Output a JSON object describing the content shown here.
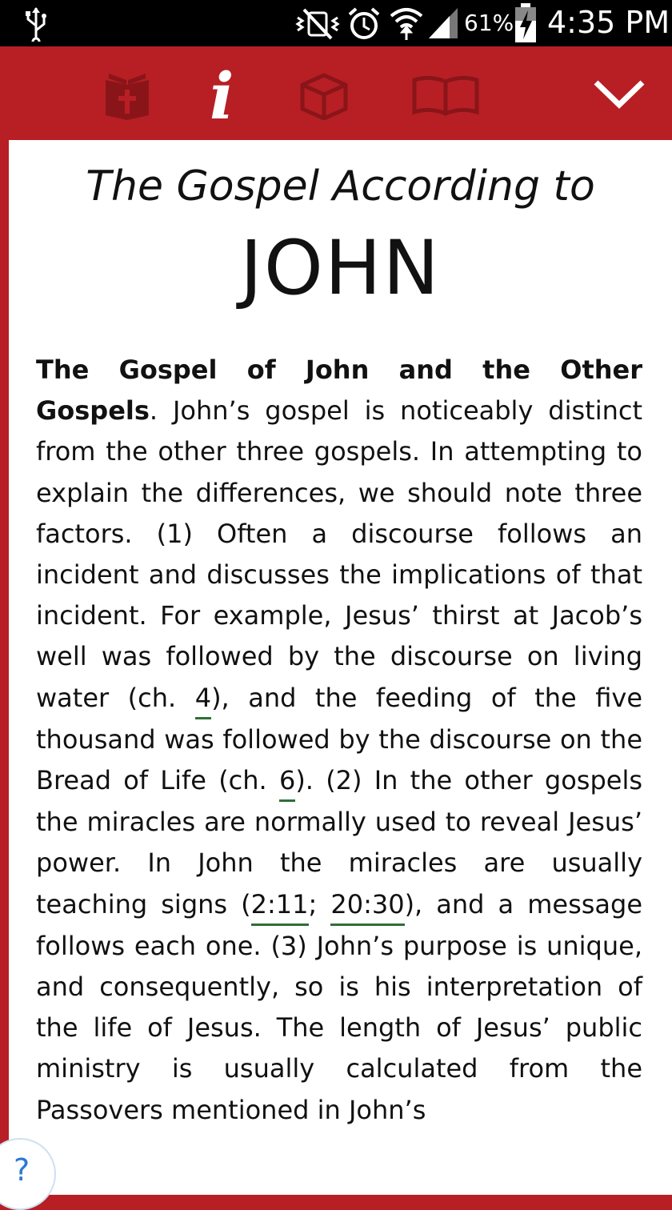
{
  "status_bar": {
    "battery_percent": "61%",
    "time": "4:35 PM",
    "icons": [
      "usb-icon",
      "vibrate-mute-icon",
      "alarm-icon",
      "wifi-icon",
      "signal-icon",
      "battery-charging-icon"
    ]
  },
  "toolbar": {
    "icons": [
      "bible-icon",
      "info-icon",
      "box-icon",
      "open-book-icon",
      "chevron-down-icon"
    ],
    "info_glyph": "i"
  },
  "content": {
    "subtitle": "The Gospel According to",
    "title": "JOHN",
    "paragraph": {
      "heading": "The Gospel of John and the Other Gospels",
      "p1": ". John’s gospel is noticeably distinct from the other three gospels. In attempting to explain the differences, we should note three factors. (1) Often a discourse follows an incident and discusses the implications of that incident. For example, Jesus’ thirst at Jacob’s well was followed by the discourse on living water (ch. ",
      "ref1": "4",
      "p2": "), and the feeding of the five thousand was followed by the discourse on the Bread of Life (ch. ",
      "ref2": "6",
      "p3": "). (2) In the other gospels the miracles are normally used to reveal Jesus’ power. In John the miracles are usually teaching signs (",
      "ref3": "2:11",
      "p4": "; ",
      "ref4": "20:30",
      "p5": "), and a message follows each one. (3) John’s purpose is unique, and consequently, so is his interpretation of the life of Jesus. The length of Jesus’ public ministry is usually calculated from the Passovers mentioned in John’s"
    }
  },
  "help_button": {
    "label": "?"
  },
  "colors": {
    "toolbar": "#b71f24",
    "toolbar_icon_inactive": "#8a1519",
    "reference_underline": "#2e6f36",
    "help_accent": "#2b78d8"
  }
}
